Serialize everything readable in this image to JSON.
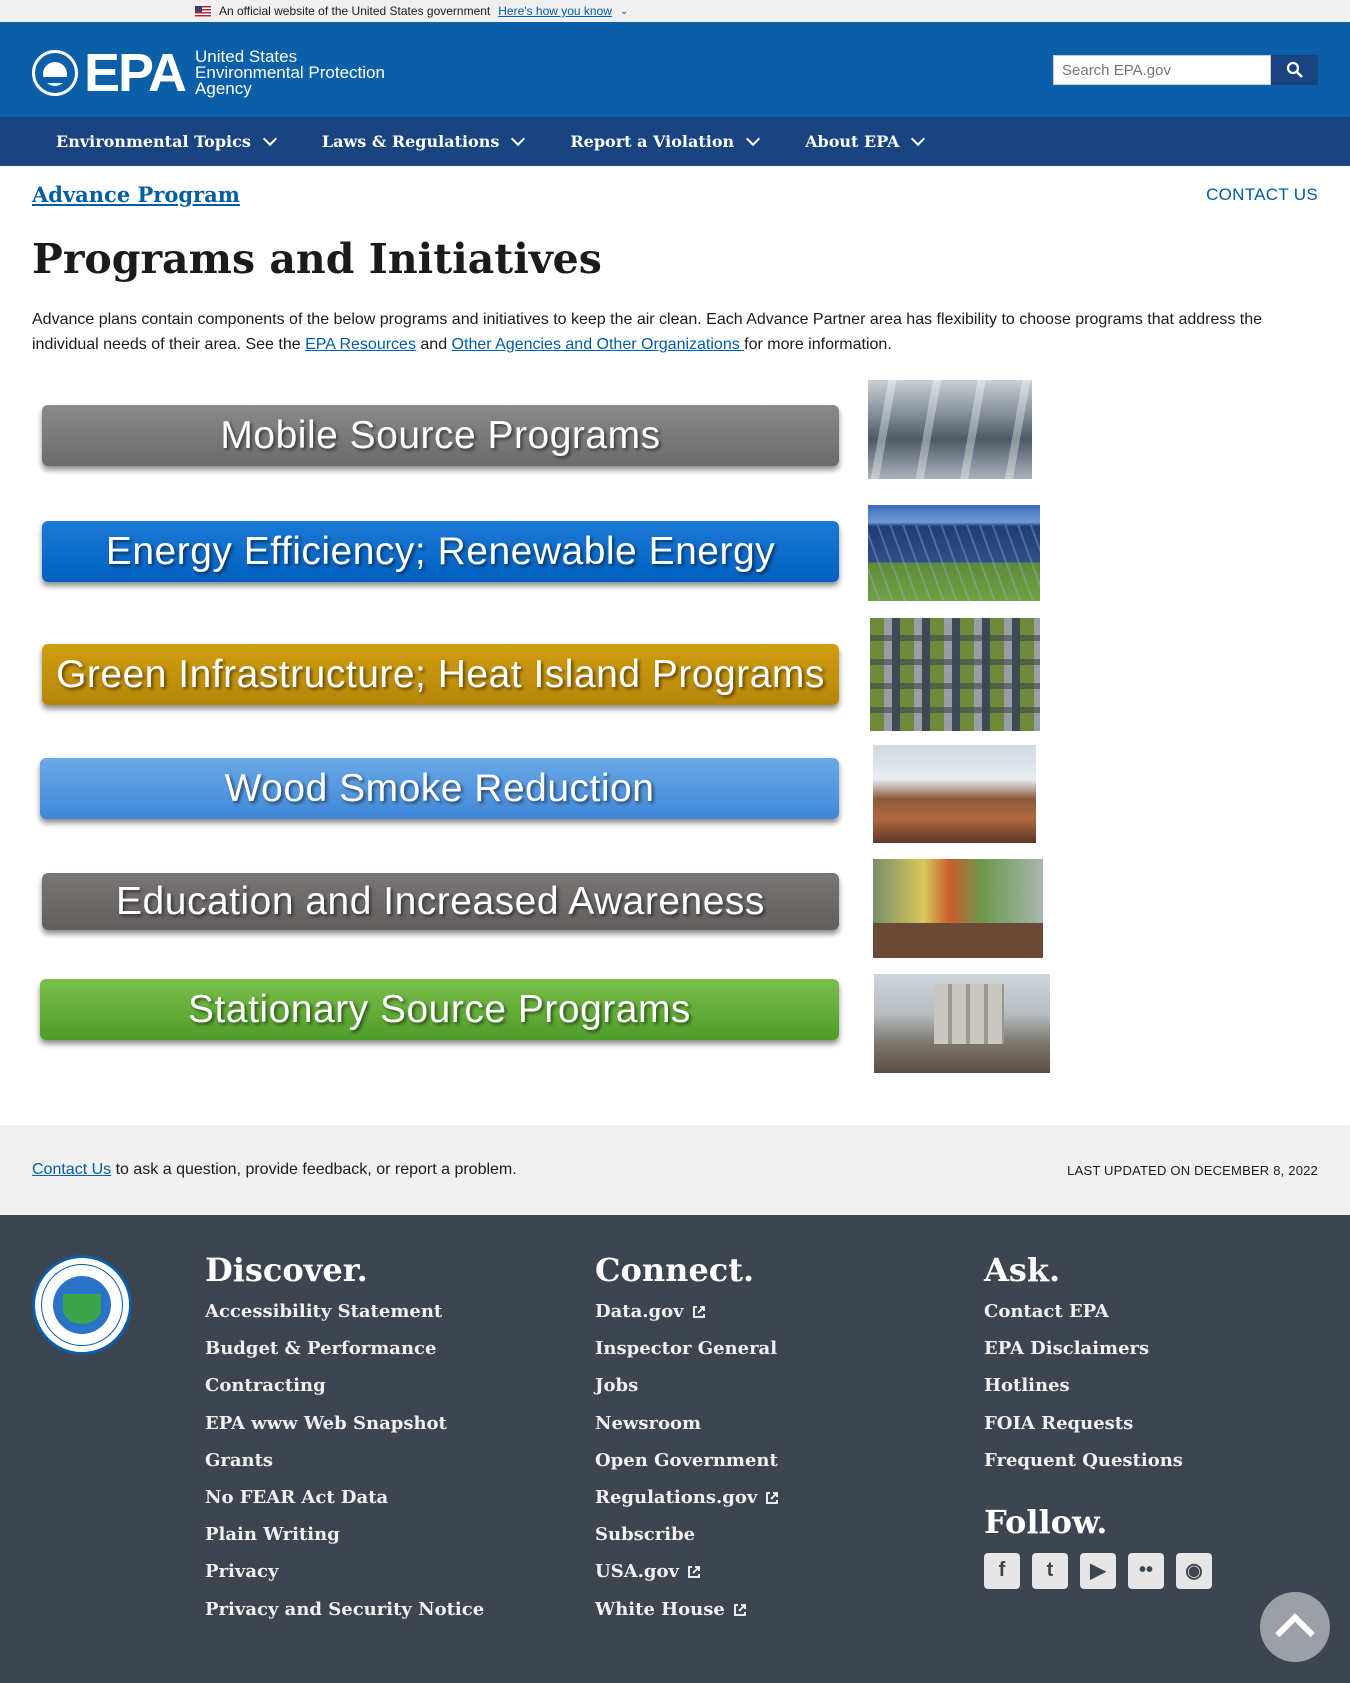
{
  "gov_banner": {
    "text": "An official website of the United States government",
    "link": "Here's how you know"
  },
  "header": {
    "logo_abbr": "EPA",
    "logo_line1": "United States",
    "logo_line2": "Environmental Protection",
    "logo_line3": "Agency",
    "search_placeholder": "Search EPA.gov"
  },
  "nav": [
    {
      "label": "Environmental Topics"
    },
    {
      "label": "Laws & Regulations"
    },
    {
      "label": "Report a Violation"
    },
    {
      "label": "About EPA"
    }
  ],
  "content": {
    "program_link": "Advance Program",
    "contact_us": "CONTACT US",
    "title": "Programs and Initiatives",
    "intro_1": "Advance plans contain components of the below programs and initiatives to keep the air clean. Each Advance Partner area has flexibility to choose programs that address the individual needs of their area. See the ",
    "intro_link1": "EPA Resources",
    "intro_2": " and ",
    "intro_link2": "Other Agencies and Other Organizations ",
    "intro_3": "for more information.",
    "programs": [
      {
        "label": "Mobile Source Programs",
        "color": "#7a7a7a",
        "image": "traffic-jam-image"
      },
      {
        "label": "Energy Efficiency; Renewable Energy",
        "color": "#0a6dcc",
        "image": "solar-panels-image"
      },
      {
        "label": "Green Infrastructure; Heat Island Programs",
        "color": "#c3920d",
        "image": "green-roofs-image"
      },
      {
        "label": "Wood Smoke Reduction",
        "color": "#549be0",
        "image": "chimney-smoke-image"
      },
      {
        "label": "Education and Increased Awareness",
        "color": "#6e6a6a",
        "image": "classroom-image"
      },
      {
        "label": "Stationary Source Programs",
        "color": "#65ae3a",
        "image": "cement-plant-image"
      }
    ]
  },
  "feedback": {
    "link": "Contact Us",
    "text": " to ask a question, provide feedback, or report a problem.",
    "updated": "LAST UPDATED ON DECEMBER 8, 2022"
  },
  "footer": {
    "discover": {
      "heading": "Discover.",
      "items": [
        "Accessibility Statement",
        "Budget & Performance",
        "Contracting",
        "EPA www Web Snapshot",
        "Grants",
        "No FEAR Act Data",
        "Plain Writing",
        "Privacy",
        "Privacy and Security Notice"
      ]
    },
    "connect": {
      "heading": "Connect.",
      "items": [
        "Data.gov",
        "Inspector General",
        "Jobs",
        "Newsroom",
        "Open Government",
        "Regulations.gov",
        "Subscribe",
        "USA.gov",
        "White House"
      ]
    },
    "ask": {
      "heading": "Ask.",
      "items": [
        "Contact EPA",
        "EPA Disclaimers",
        "Hotlines",
        "FOIA Requests",
        "Frequent Questions"
      ]
    },
    "follow": {
      "heading": "Follow.",
      "icons": [
        "facebook-icon",
        "twitter-icon",
        "youtube-icon",
        "flickr-icon",
        "instagram-icon"
      ]
    }
  }
}
